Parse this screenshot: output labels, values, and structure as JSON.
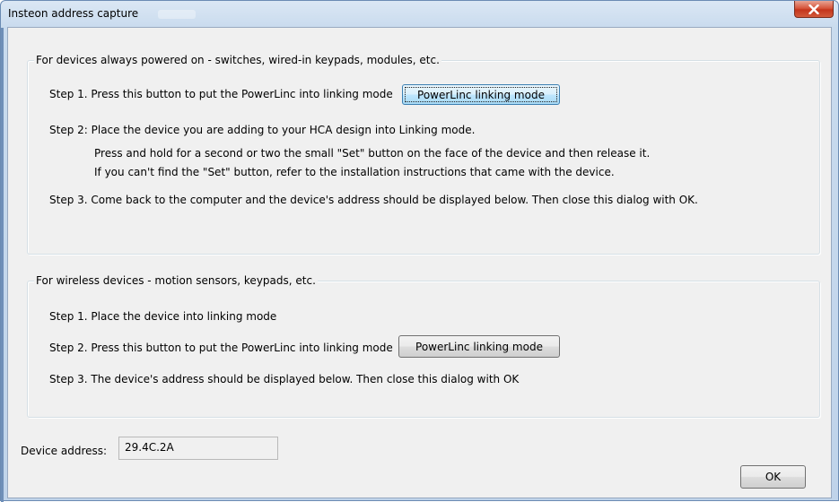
{
  "window": {
    "title": "Insteon address capture",
    "close_label": "X"
  },
  "wired_group": {
    "legend": "For devices always powered on - switches, wired-in keypads, modules, etc.",
    "step1_text": "Step 1. Press this button to put the PowerLinc into linking mode",
    "step1_button": "PowerLinc linking mode",
    "step2_text": "Step 2:  Place the device you are adding to your HCA design into Linking mode.",
    "step2_detail1": "Press and hold for a second or two the small \"Set\" button on the face of the device and then release it.",
    "step2_detail2": "If you can't find the \"Set\" button, refer to the installation instructions that came with the device.",
    "step3_text": "Step 3. Come back to the computer and the device's address should be displayed below.  Then close this dialog with OK."
  },
  "wireless_group": {
    "legend": "For wireless devices - motion sensors, keypads, etc.",
    "step1_text": "Step 1. Place the device into linking mode",
    "step2_text": "Step 2. Press this button to put the PowerLinc into linking mode",
    "step2_button": "PowerLinc linking mode",
    "step3_text": "Step 3. The device's address should be displayed below.  Then close this dialog with OK"
  },
  "device_address": {
    "label": "Device address:",
    "value": "29.4C.2A"
  },
  "footer": {
    "ok_label": "OK"
  }
}
